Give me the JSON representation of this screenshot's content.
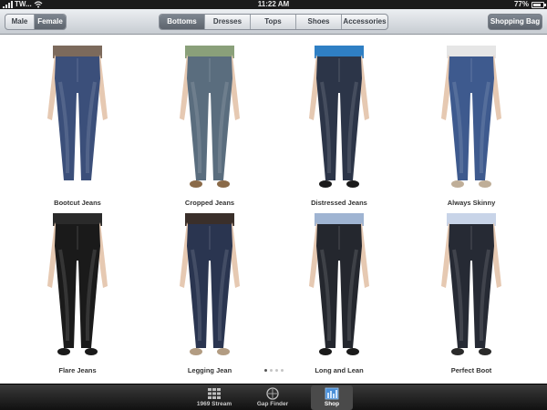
{
  "status_bar": {
    "carrier": "TW...",
    "time": "11:22 AM",
    "battery": "77%",
    "battery_level": 0.77
  },
  "nav": {
    "gender_options": [
      "Male",
      "Female"
    ],
    "gender_selected": "Female",
    "category_options": [
      "Bottoms",
      "Dresses",
      "Tops",
      "Shoes",
      "Accessories"
    ],
    "category_selected": "Bottoms",
    "shopping_bag_label": "Shopping Bag"
  },
  "products": [
    {
      "name": "Bootcut Jeans",
      "shade": "#3b4f7a",
      "top": "#7c6a5c",
      "shoe": "none"
    },
    {
      "name": "Cropped Jeans",
      "shade": "#5a6d7e",
      "top": "#8aa07a",
      "shoe": "#8a6a48"
    },
    {
      "name": "Distressed Jeans",
      "shade": "#2c3548",
      "top": "#2f7fc4",
      "shoe": "#1a1a1a"
    },
    {
      "name": "Always Skinny",
      "shade": "#3e5a8e",
      "top": "#e6e6e6",
      "shoe": "#bfae98"
    },
    {
      "name": "Flare Jeans",
      "shade": "#1a1a1a",
      "top": "#2a2a2a",
      "shoe": "#1a1a1a"
    },
    {
      "name": "Legging Jean",
      "shade": "#2a3550",
      "top": "#3a2f2a",
      "shoe": "#b29c82"
    },
    {
      "name": "Long and Lean",
      "shade": "#24272e",
      "top": "#9fb4d2",
      "shoe": "#1a1a1a"
    },
    {
      "name": "Perfect Boot",
      "shade": "#262a34",
      "top": "#c8d4e8",
      "shoe": "#2a2a2a"
    }
  ],
  "pager": {
    "pages": 4,
    "current": 1
  },
  "tabs": [
    {
      "label": "1969 Stream",
      "icon": "grid-icon",
      "active": false
    },
    {
      "label": "Gap Finder",
      "icon": "compass-icon",
      "active": false
    },
    {
      "label": "Shop",
      "icon": "shop-icon",
      "active": true
    }
  ]
}
